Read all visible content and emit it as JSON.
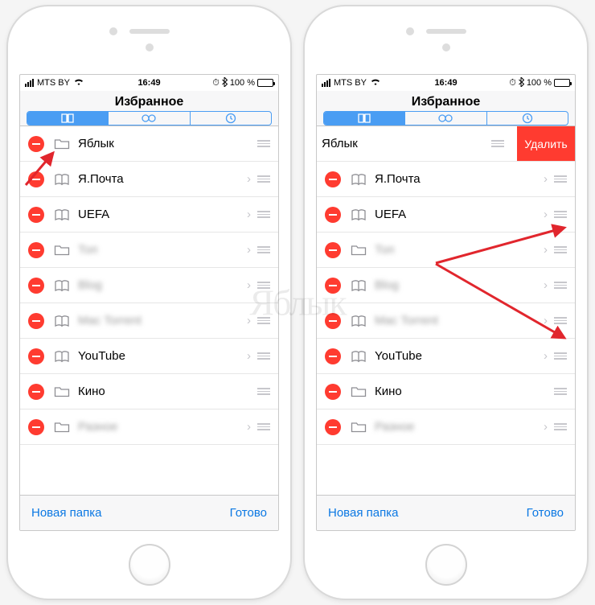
{
  "status": {
    "carrier": "MTS BY",
    "wifi": "≈",
    "time": "16:49",
    "bt": "#",
    "battery": "100 %"
  },
  "header": {
    "title": "Избранное"
  },
  "footer": {
    "new_folder": "Новая папка",
    "done": "Готово"
  },
  "delete_label": "Удалить",
  "rows_left": [
    {
      "icon": "folder",
      "label": "Яблык",
      "chev": false
    },
    {
      "icon": "book",
      "label": "Я.Почта",
      "chev": true
    },
    {
      "icon": "book",
      "label": "UEFA",
      "chev": true
    },
    {
      "icon": "folder",
      "label": "Топ",
      "chev": true,
      "blur": true
    },
    {
      "icon": "book",
      "label": "Blog",
      "chev": true,
      "blur": true
    },
    {
      "icon": "book",
      "label": "Mac Torrent",
      "chev": true,
      "blur": true
    },
    {
      "icon": "book",
      "label": "YouTube",
      "chev": true
    },
    {
      "icon": "folder",
      "label": "Кино",
      "chev": false
    },
    {
      "icon": "folder",
      "label": "Разное",
      "chev": true,
      "blur": true
    }
  ],
  "rows_right": [
    {
      "icon": "folder",
      "label": "Яблык",
      "swiped": true
    },
    {
      "icon": "book",
      "label": "Я.Почта",
      "chev": true
    },
    {
      "icon": "book",
      "label": "UEFA",
      "chev": true
    },
    {
      "icon": "folder",
      "label": "Топ",
      "chev": true,
      "blur": true
    },
    {
      "icon": "book",
      "label": "Blog",
      "chev": true,
      "blur": true
    },
    {
      "icon": "book",
      "label": "Mac Torrent",
      "chev": true,
      "blur": true
    },
    {
      "icon": "book",
      "label": "YouTube",
      "chev": true
    },
    {
      "icon": "folder",
      "label": "Кино",
      "chev": false
    },
    {
      "icon": "folder",
      "label": "Разное",
      "chev": true,
      "blur": true
    }
  ]
}
